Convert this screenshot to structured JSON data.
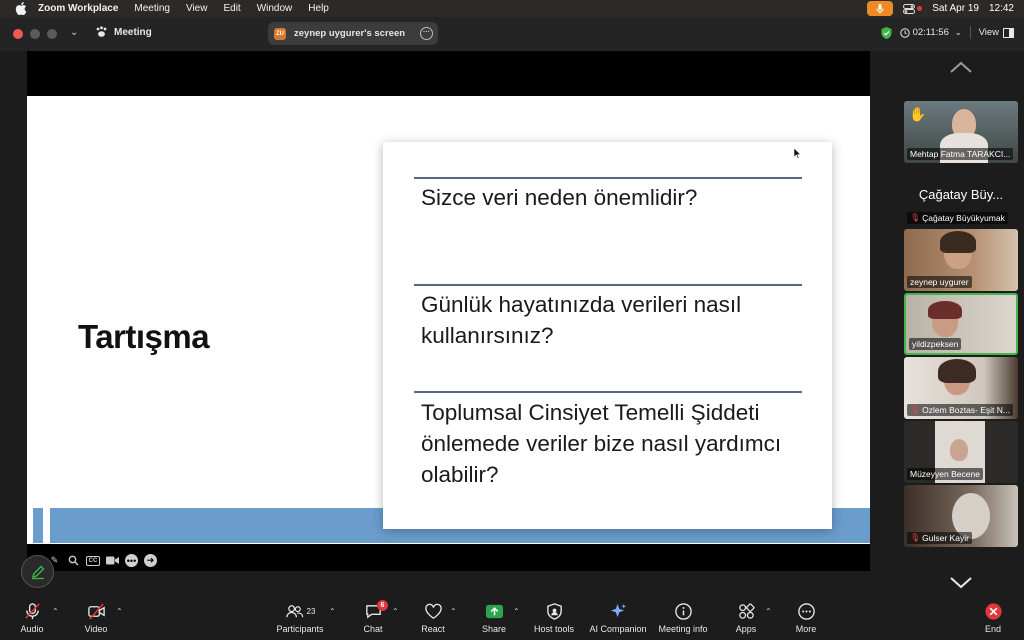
{
  "menubar": {
    "app": "Zoom Workplace",
    "items": [
      "Meeting",
      "View",
      "Edit",
      "Window",
      "Help"
    ],
    "date": "Sat Apr 19",
    "time": "12:42"
  },
  "titlebar": {
    "meeting_label": "Meeting",
    "screen_pill_badge": "ZU",
    "screen_title": "zeynep uygurer's screen",
    "timer": "02:11:56",
    "view_label": "View"
  },
  "slide": {
    "title": "Tartışma",
    "questions": [
      "Sizce veri neden önemlidir?",
      "Günlük hayatınızda verileri nasıl kullanırsınız?",
      "Toplumsal Cinsiyet Temelli Şiddeti önlemede veriler bize nasıl yardımcı olabilir?"
    ]
  },
  "participants": [
    {
      "name": "Mehtap Fatma TARAKCI...",
      "hand": true
    },
    {
      "name": "Çağatay Büyükyumak",
      "display": "Çağatay Büy...",
      "muted": true
    },
    {
      "name": "zeynep uygurer"
    },
    {
      "name": "yildizpeksen",
      "active": true
    },
    {
      "name": "Ozlem Boztas- Eşit N...",
      "muted": true
    },
    {
      "name": "Müzeyyen Becene"
    },
    {
      "name": "Gulser Kayir",
      "muted": true
    }
  ],
  "toolbar": {
    "audio": "Audio",
    "video": "Video",
    "participants": "Participants",
    "participants_count": "23",
    "chat": "Chat",
    "chat_badge": "6",
    "react": "React",
    "share": "Share",
    "host_tools": "Host tools",
    "ai_companion": "AI Companion",
    "meeting_info": "Meeting info",
    "apps": "Apps",
    "more": "More",
    "end": "End"
  },
  "colors": {
    "accent_green": "#43b54a",
    "share_green": "#2ea44f",
    "end_red": "#e0363d",
    "mic_orange": "#f08a24",
    "slide_band": "#6a9ccc"
  }
}
